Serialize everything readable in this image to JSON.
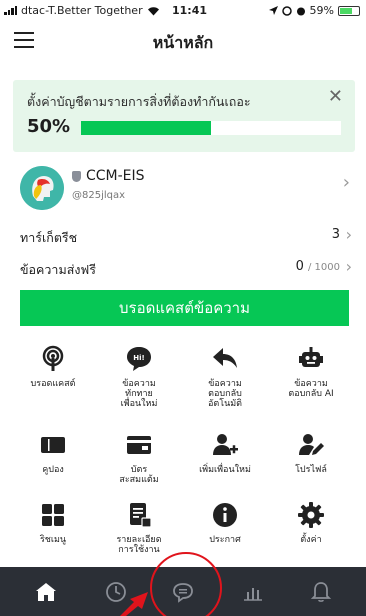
{
  "status_bar": {
    "carrier": "dtac-T.Better Together",
    "time": "11:41",
    "battery": "59%"
  },
  "header": {
    "title": "หน้าหลัก"
  },
  "banner": {
    "text": "ตั้งค่าบัญชีตามรายการสิ่งที่ต้องทำกันเถอะ",
    "percent_label": "50%",
    "progress": 0.5
  },
  "profile": {
    "name": "CCM-EIS",
    "id": "@825jlqax"
  },
  "rows": {
    "target": {
      "label": "ทาร์เก็ตรีช",
      "value": "3"
    },
    "free_messages": {
      "label": "ข้อความส่งฟรี",
      "value": "0",
      "limit": "/ 1000"
    }
  },
  "broadcast_button": "บรอดแคสต์ข้อความ",
  "menu": [
    {
      "icon": "broadcast-icon",
      "label": "บรอดแคสต์"
    },
    {
      "icon": "greeting-message-icon",
      "label": "ข้อความ\nทักทาย\nเพื่อนใหม่"
    },
    {
      "icon": "auto-reply-icon",
      "label": "ข้อความ\nตอบกลับ\nอัตโนมัติ"
    },
    {
      "icon": "ai-reply-icon",
      "label": "ข้อความ\nตอบกลับ AI"
    },
    {
      "icon": "coupon-icon",
      "label": "คูปอง"
    },
    {
      "icon": "reward-card-icon",
      "label": "บัตร\nสะสมแต้ม"
    },
    {
      "icon": "add-friend-icon",
      "label": "เพิ่มเพื่อนใหม่"
    },
    {
      "icon": "profile-edit-icon",
      "label": "โปรไฟล์"
    },
    {
      "icon": "rich-menu-icon",
      "label": "ริชเมนู"
    },
    {
      "icon": "usage-report-icon",
      "label": "รายละเอียด\nการใช้งาน"
    },
    {
      "icon": "announcement-icon",
      "label": "ประกาศ"
    },
    {
      "icon": "settings-gear-icon",
      "label": "ตั้งค่า"
    }
  ],
  "tabbar": [
    "home-icon",
    "clock-icon",
    "chat-icon",
    "insight-chart-icon",
    "bell-icon"
  ],
  "colors": {
    "accent": "#06c755",
    "tabbar": "#2b2f36",
    "banner": "#e6f6ea",
    "annotation": "#e0141c"
  }
}
